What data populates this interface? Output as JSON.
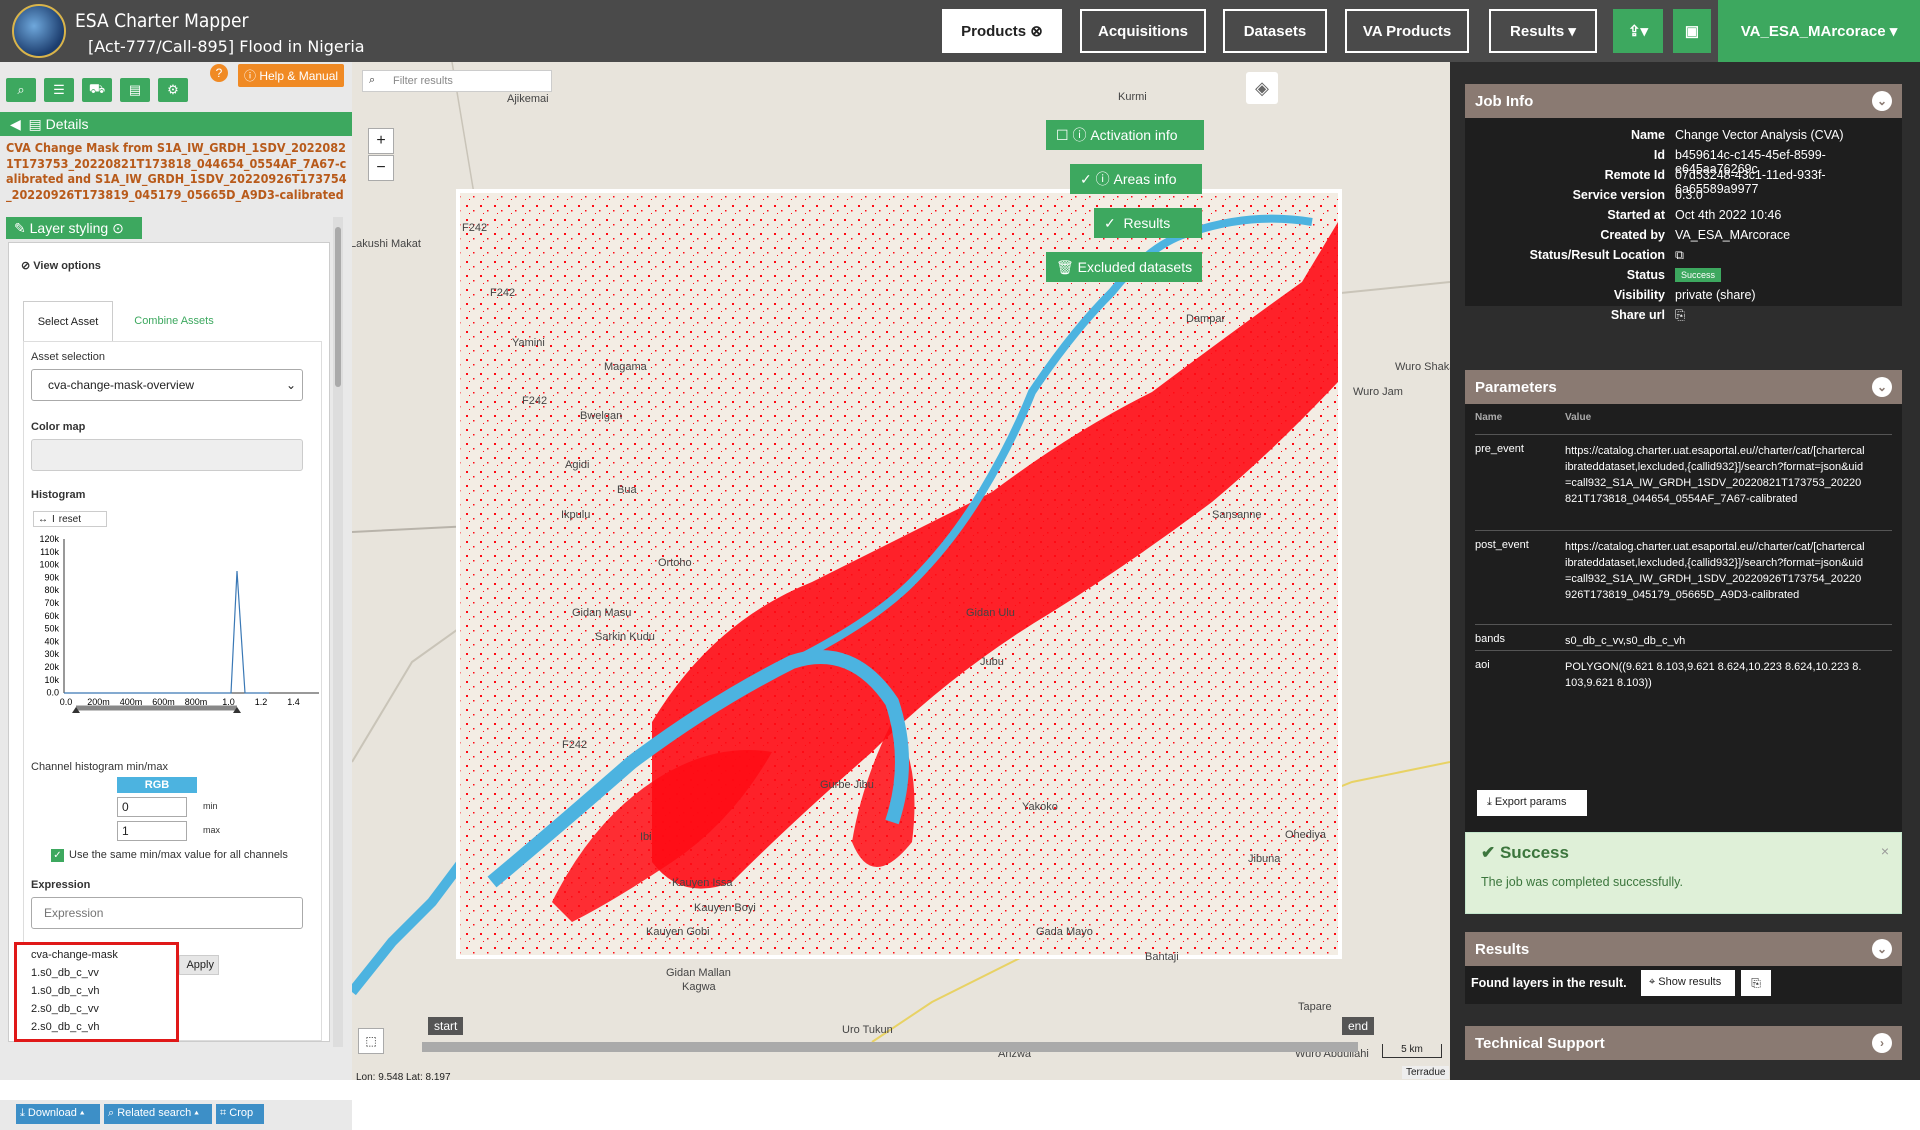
{
  "app": {
    "title": "ESA Charter Mapper",
    "subtitle": "[Act-777/Call-895] Flood in Nigeria"
  },
  "nav": {
    "products": "Products",
    "acquisitions": "Acquisitions",
    "datasets": "Datasets",
    "va_products": "VA Products",
    "results": "Results",
    "user": "VA_ESA_MArcorace"
  },
  "left": {
    "help": "Help & Manual",
    "details": "Details",
    "product_title": "CVA Change Mask from S1A_IW_GRDH_1SDV_20220821T173753_20220821T173818_044654_0554AF_7A67-calibrated and S1A_IW_GRDH_1SDV_20220926T173754_20220926T173819_045179_05665D_A9D3-calibrated",
    "layer_styling": "Layer styling",
    "view_options": "View options",
    "tabs": [
      "Select Asset",
      "Combine Assets"
    ],
    "asset_selection": "Asset selection",
    "asset_value": "cva-change-mask-overview",
    "color_map": "Color map",
    "histogram": "Histogram",
    "reset": "reset",
    "y_ticks": [
      "120k",
      "110k",
      "100k",
      "90k",
      "80k",
      "70k",
      "60k",
      "50k",
      "40k",
      "30k",
      "20k",
      "10k",
      "0.0"
    ],
    "x_ticks": [
      "0.0",
      "200m",
      "400m",
      "600m",
      "800m",
      "1.0",
      "1.2",
      "1.4"
    ],
    "channel_minmax": "Channel histogram min/max",
    "rgb": "RGB",
    "min_val": "0",
    "max_val": "1",
    "min": "min",
    "max": "max",
    "same_minmax": "Use the same min/max value for all channels",
    "expression": "Expression",
    "expression_placeholder": "Expression",
    "apply": "Apply",
    "asset_list": [
      "cva-change-mask",
      "1.s0_db_c_vv",
      "1.s0_db_c_vh",
      "2.s0_db_c_vv",
      "2.s0_db_c_vh"
    ],
    "download": "Download",
    "related_search": "Related search",
    "crop": "Crop",
    "coords": "Lon: 9.548 Lat: 8.197"
  },
  "map": {
    "filter_placeholder": "Filter results",
    "activation_info": "Activation info",
    "areas_info": "Areas info",
    "results": "Results",
    "excluded": "Excluded datasets",
    "start": "start",
    "end": "end",
    "scale": "5 km",
    "attribution": "Terradue",
    "places": [
      [
        "Ajikemai",
        507,
        102
      ],
      [
        "Kurmi",
        1118,
        100
      ],
      [
        "Lakushi Makat",
        350,
        247
      ],
      [
        "F242",
        462,
        231
      ],
      [
        "F242",
        490,
        296
      ],
      [
        "Yamini",
        512,
        346
      ],
      [
        "Magama",
        604,
        370
      ],
      [
        "F242",
        522,
        404
      ],
      [
        "Bwelgan",
        580,
        419
      ],
      [
        "Agidi",
        565,
        468
      ],
      [
        "Bua",
        617,
        493
      ],
      [
        "Ikpulu",
        561,
        518
      ],
      [
        "Ortoho",
        658,
        566
      ],
      [
        "Gidan Masu",
        572,
        616
      ],
      [
        "Sarkin Kudu",
        595,
        640
      ],
      [
        "Gidan Ulu",
        966,
        616
      ],
      [
        "Jubu",
        980,
        665
      ],
      [
        "Dampar",
        1186,
        322
      ],
      [
        "Wuro Shaka",
        1395,
        370
      ],
      [
        "Wuro Jam",
        1353,
        395
      ],
      [
        "Sansanne",
        1212,
        518
      ],
      [
        "F242",
        562,
        748
      ],
      [
        "Gurbe Jibu",
        820,
        788
      ],
      [
        "Ibi",
        640,
        840
      ],
      [
        "Kauyen Issa",
        672,
        886
      ],
      [
        "Kauyen Boyi",
        694,
        911
      ],
      [
        "Kauyen Gobi",
        646,
        935
      ],
      [
        "Gada Mayo",
        1036,
        935
      ],
      [
        "Yakoko",
        1022,
        810
      ],
      [
        "Ohediya",
        1285,
        838
      ],
      [
        "Jibuna",
        1248,
        862
      ],
      [
        "Bantaji",
        1145,
        960
      ],
      [
        "Gidan Mallan",
        666,
        976
      ],
      [
        "Kagwa",
        682,
        990
      ],
      [
        "Tapare",
        1298,
        1010
      ],
      [
        "Uro Tukun",
        842,
        1033
      ],
      [
        "Anzwa",
        998,
        1057
      ],
      [
        "Wuro Abdullahi",
        1295,
        1057
      ]
    ]
  },
  "job": {
    "header": "Job Info",
    "rows": [
      [
        "Name",
        "Change Vector Analysis (CVA)"
      ],
      [
        "Id",
        "b459614c-c145-45ef-8599-e645aa76269c"
      ],
      [
        "Remote Id",
        "07d53248-43c1-11ed-933f-6a65589a9977"
      ],
      [
        "Service version",
        "0.3.0"
      ],
      [
        "Started at",
        "Oct 4th 2022 10:46"
      ],
      [
        "Created by",
        "VA_ESA_MArcorace"
      ],
      [
        "Status/Result Location",
        ""
      ],
      [
        "Status",
        "Success"
      ],
      [
        "Visibility",
        "private (share)"
      ],
      [
        "Share url",
        ""
      ]
    ]
  },
  "params": {
    "header": "Parameters",
    "col_name": "Name",
    "col_value": "Value",
    "rows": [
      [
        "pre_event",
        "https://catalog.charter.uat.esaportal.eu//charter/cat/[chartercalibrateddataset,lexcluded,{callid932}]/search?format=json&uid=call932_S1A_IW_GRDH_1SDV_20220821T173753_20220821T173818_044654_0554AF_7A67-calibrated"
      ],
      [
        "post_event",
        "https://catalog.charter.uat.esaportal.eu//charter/cat/[chartercalibrateddataset,lexcluded,{callid932}]/search?format=json&uid=call932_S1A_IW_GRDH_1SDV_20220926T173754_20220926T173819_045179_05665D_A9D3-calibrated"
      ],
      [
        "bands",
        "s0_db_c_vv,s0_db_c_vh"
      ],
      [
        "aoi",
        "POLYGON((9.621 8.103,9.621 8.624,10.223 8.624,10.223 8.103,9.621 8.103))"
      ]
    ],
    "export": "Export params"
  },
  "success": {
    "title": "Success",
    "msg": "The job was completed successfully."
  },
  "results_box": {
    "header": "Results",
    "found": "Found layers in the result.",
    "show": "Show results"
  },
  "support": {
    "header": "Technical Support"
  },
  "colors": {
    "green": "#3da85f",
    "flood": "#ff0a14",
    "water": "#4cb3e0",
    "panel": "#2d2d2d",
    "box_header": "#8a7a72"
  }
}
